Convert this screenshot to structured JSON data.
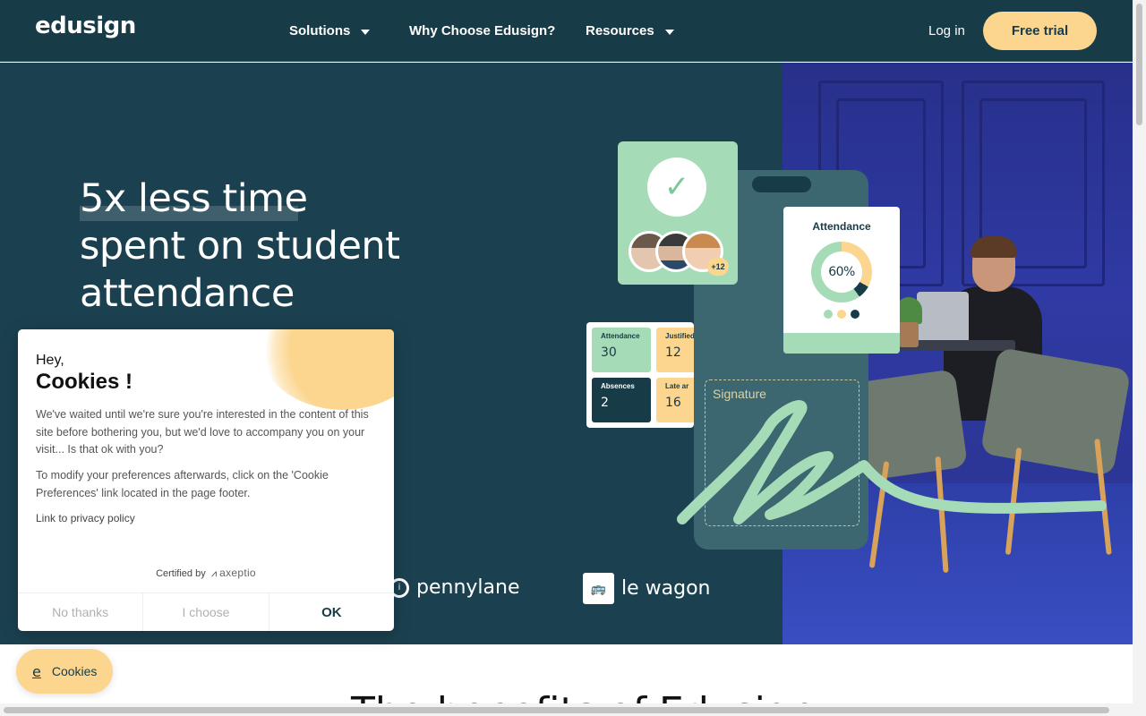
{
  "header": {
    "logo": "edusign",
    "nav": [
      {
        "label": "Solutions",
        "has_dropdown": true
      },
      {
        "label": "Why Choose Edusign?",
        "has_dropdown": false
      },
      {
        "label": "Resources",
        "has_dropdown": true
      }
    ],
    "login": "Log in",
    "cta": "Free trial"
  },
  "hero": {
    "headline_lines": [
      "5x less time",
      "spent on student",
      "attendance"
    ],
    "attendance_card": {
      "title": "Attendance",
      "percent": "60%"
    },
    "stats": [
      {
        "label": "Attendance",
        "value": "30"
      },
      {
        "label": "Justified",
        "value": "12"
      },
      {
        "label": "Absences",
        "value": "2"
      },
      {
        "label": "Late ar",
        "value": "16"
      }
    ],
    "avatar_extra": "+12",
    "signature_label": "Signature",
    "partners": [
      "pennylane",
      "le wagon"
    ]
  },
  "cookie_dialog": {
    "greeting": "Hey,",
    "title": "Cookies !",
    "paragraph1": "We've waited until we're sure you're interested in the content of this site before bothering you, but we'd love to accompany you on your visit... Is that ok with you?",
    "paragraph2": "To modify your preferences afterwards, click on the 'Cookie Preferences' link located in the page footer.",
    "privacy_link": "Link to privacy policy",
    "certified_by": "Certified by",
    "certifier": "axeptio",
    "buttons": {
      "no": "No thanks",
      "choose": "I choose",
      "ok": "OK"
    }
  },
  "cookie_pill": {
    "label": "Cookies"
  },
  "colors": {
    "brand_dark": "#173b47",
    "hero_bg": "#1b4150",
    "accent_yellow": "#fcd58e",
    "accent_green": "#a6dbb8"
  }
}
